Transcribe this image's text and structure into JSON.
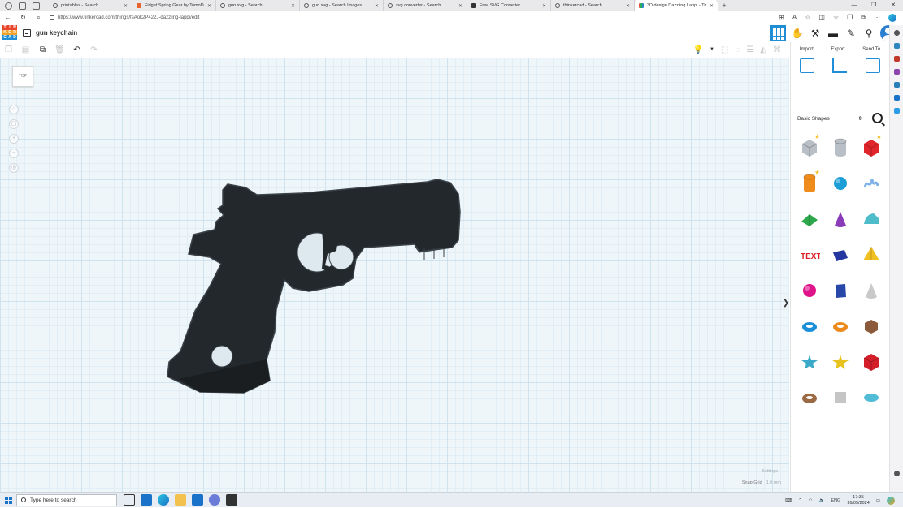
{
  "browser": {
    "tabs": [
      {
        "label": "printables - Search",
        "favicon": "search-icon"
      },
      {
        "label": "Fidget Spring Gear by TomoDes",
        "favicon": "printables-icon"
      },
      {
        "label": "gun svg - Search",
        "favicon": "search-icon"
      },
      {
        "label": "gun svg - Search Images",
        "favicon": "search-icon"
      },
      {
        "label": "svg converter - Search",
        "favicon": "search-icon"
      },
      {
        "label": "Free SVG Converter",
        "favicon": "converter-icon"
      },
      {
        "label": "thinkercad - Search",
        "favicon": "search-icon"
      },
      {
        "label": "3D design Dazzling Lappi - Tinke",
        "favicon": "tinkercad-icon"
      }
    ],
    "new_tab": "+",
    "url": "https://www.tinkercad.com/things/fsAok2P422J-dazzling-lappi/edit"
  },
  "app": {
    "logo_letters": [
      "T",
      "I",
      "N",
      "K",
      "E",
      "R",
      "C",
      "A",
      "D"
    ],
    "design_name": "gun keychain",
    "panel_tabs": [
      "Import",
      "Export",
      "Send To"
    ],
    "shape_library": "Basic Shapes",
    "view_cube_label": "TOP",
    "settings_label": "Settings",
    "snap_grid_label": "Snap Grid",
    "snap_grid_value": "1.0 mm",
    "accent_color": "#1f8ed6",
    "object_color": "#23282c",
    "shapes": [
      {
        "name": "box-hole",
        "color": "#b9bfc6",
        "starred": true
      },
      {
        "name": "cylinder-hole",
        "color": "#b9bfc6",
        "starred": false
      },
      {
        "name": "box",
        "color": "#e0262c",
        "starred": true
      },
      {
        "name": "cylinder",
        "color": "#ef8c1c",
        "starred": true
      },
      {
        "name": "sphere",
        "color": "#1b9ed6",
        "starred": false
      },
      {
        "name": "scribble",
        "color": "#7fb3e8",
        "starred": false
      },
      {
        "name": "roof",
        "color": "#2ea84c",
        "starred": false
      },
      {
        "name": "cone",
        "color": "#8a3bb8",
        "starred": false
      },
      {
        "name": "round-roof",
        "color": "#4fbcc9",
        "starred": false
      },
      {
        "name": "text",
        "color": "#d92027",
        "starred": false
      },
      {
        "name": "wedge",
        "color": "#2437a1",
        "starred": false
      },
      {
        "name": "pyramid",
        "color": "#f0c020",
        "starred": false
      },
      {
        "name": "half-sphere",
        "color": "#e0148a",
        "starred": false
      },
      {
        "name": "polygon",
        "color": "#2748a8",
        "starred": false
      },
      {
        "name": "paraboloid",
        "color": "#c9c9c9",
        "starred": false
      },
      {
        "name": "torus",
        "color": "#1a8fd8",
        "starred": false
      },
      {
        "name": "tube",
        "color": "#ec8a1c",
        "starred": false
      },
      {
        "name": "icosahedron",
        "color": "#8a5a3a",
        "starred": false
      },
      {
        "name": "star",
        "color": "#3aa8c8",
        "starred": false
      },
      {
        "name": "star-gold",
        "color": "#e8c31e",
        "starred": false
      },
      {
        "name": "polyhedron",
        "color": "#d41f2b",
        "starred": false
      },
      {
        "name": "ring",
        "color": "#9a6a45",
        "starred": false
      },
      {
        "name": "heart-hole",
        "color": "#c5c5c5",
        "starred": false
      },
      {
        "name": "ellipsoid",
        "color": "#50bcd6",
        "starred": false
      }
    ]
  },
  "taskbar": {
    "search_placeholder": "Type here to search",
    "language": "ENG",
    "time": "17:35",
    "date": "16/05/2024"
  }
}
